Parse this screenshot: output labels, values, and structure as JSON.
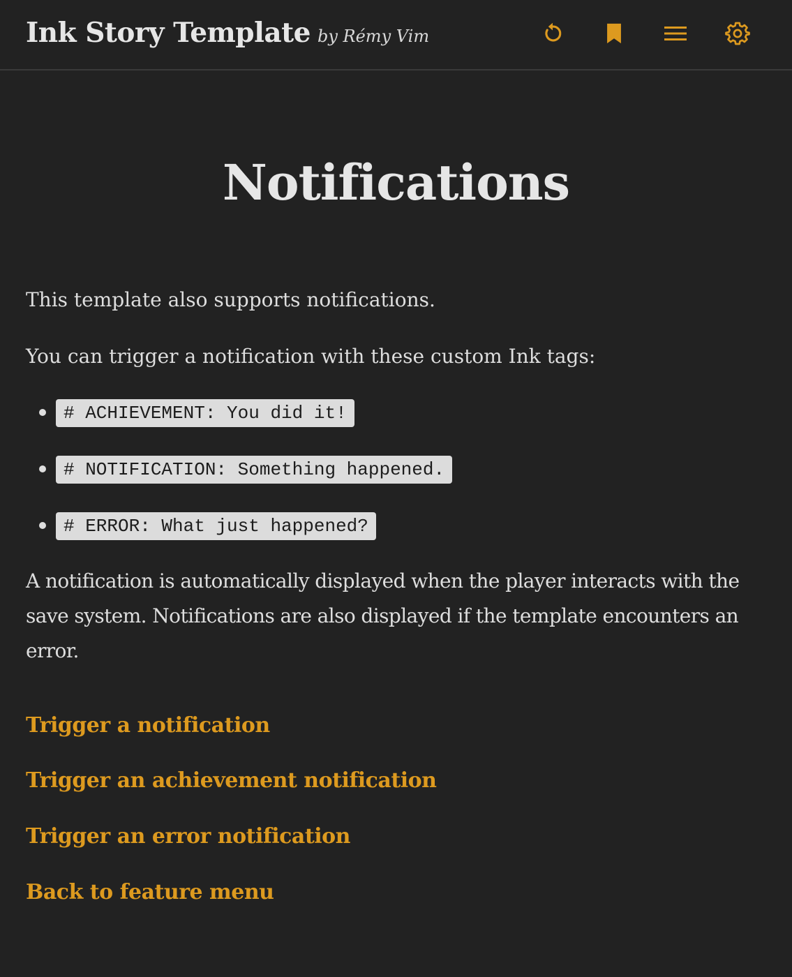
{
  "header": {
    "title": "Ink Story Template",
    "author": "by Rémy Vim",
    "accent_color": "#dd9a1f",
    "buttons": [
      {
        "icon": "restart-icon"
      },
      {
        "icon": "bookmark-icon"
      },
      {
        "icon": "menu-icon"
      },
      {
        "icon": "gear-icon"
      }
    ]
  },
  "main": {
    "title": "Notifications",
    "paragraphs": [
      "This template also supports notifications.",
      "You can trigger a notification with these custom Ink tags:",
      "A notification is automatically displayed when the player interacts with the save system. Notifications are also displayed if the template encounters an error."
    ],
    "tags": [
      "# ACHIEVEMENT: You did it!",
      "# NOTIFICATION: Something happened.",
      "# ERROR: What just happened?"
    ],
    "choices": [
      "Trigger a notification",
      "Trigger an achievement notification",
      "Trigger an error notification",
      "Back to feature menu"
    ]
  }
}
